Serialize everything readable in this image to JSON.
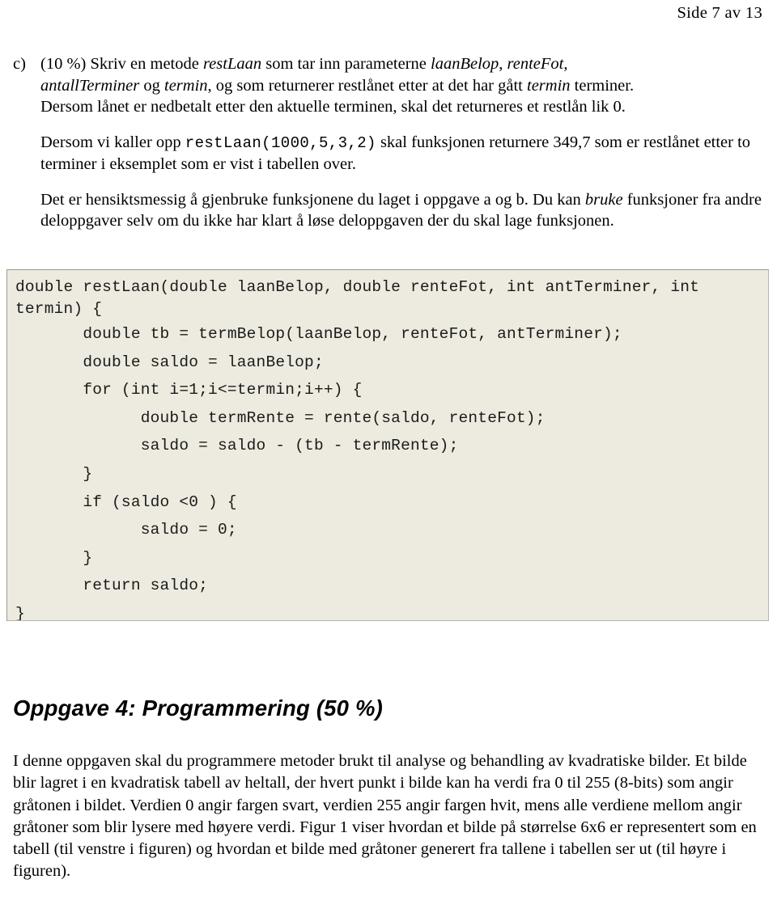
{
  "header": {
    "page_label": "Side 7 av 13"
  },
  "task": {
    "marker": "c)",
    "line1_pre": "(10 %) Skriv en metode ",
    "line1_em1": "restLaan",
    "line1_mid": " som tar inn parameterne ",
    "line1_em2": "laanBelop",
    "line1_sep": ", ",
    "line1_em3": "renteFot",
    "line1_post": ",",
    "line2_em1": "antallTerminer",
    "line2_mid": " og ",
    "line2_em2": "termin",
    "line2_post": ", og som returnerer restlånet etter at det har gått ",
    "line2_em3": "termin",
    "line2_end": " terminer.",
    "line3": "Dersom lånet er nedbetalt etter den aktuelle terminen, skal det returneres et restlån lik 0."
  },
  "paragraphs": {
    "p1_pre": "Dersom vi kaller opp ",
    "p1_code": "restLaan(1000,5,3,2)",
    "p1_post": " skal funksjonen returnere 349,7 som er restlånet etter to terminer i eksemplet som er vist i tabellen over.",
    "p2_pre": "Det er hensiktsmessig å gjenbruke funksjonene du laget i oppgave a og b. Du kan ",
    "p2_em": "bruke",
    "p2_post": " funksjoner fra andre deloppgaver selv om du ikke har klart å løse deloppgaven der du skal lage funksjonen."
  },
  "code": {
    "lines": [
      "double restLaan(double laanBelop, double renteFot, int antTerminer, int",
      "termin) {",
      "       double tb = termBelop(laanBelop, renteFot, antTerminer);",
      "       double saldo = laanBelop;",
      "       for (int i=1;i<=termin;i++) {",
      "             double termRente = rente(saldo, renteFot);",
      "             saldo = saldo - (tb - termRente);",
      "       }",
      "       if (saldo <0 ) {",
      "             saldo = 0;",
      "       }",
      "       return saldo;",
      "}"
    ]
  },
  "section": {
    "heading": "Oppgave 4: Programmering (50 %)",
    "body": "I denne oppgaven skal du programmere metoder brukt til analyse og behandling av kvadratiske bilder. Et bilde blir lagret i en kvadratisk tabell av heltall, der hvert punkt i bilde kan ha verdi fra 0 til 255 (8-bits) som angir gråtonen i bildet. Verdien 0 angir fargen svart, verdien 255 angir fargen hvit, mens alle verdiene mellom angir gråtoner som blir lysere med høyere verdi. Figur 1 viser hvordan et bilde på størrelse 6x6 er representert som en tabell (til venstre i figuren) og hvordan et bilde med gråtoner generert fra tallene i tabellen ser ut (til høyre i figuren)."
  },
  "colors": {
    "page_background": "#ffffff",
    "code_background": "#edebe0",
    "code_border": "#9a9a90",
    "text": "#000000"
  }
}
